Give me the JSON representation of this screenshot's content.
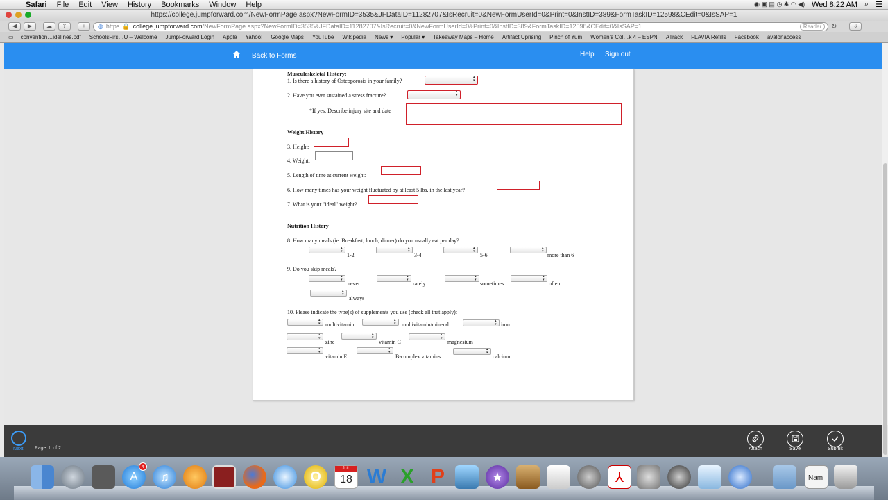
{
  "menubar": {
    "app": "Safari",
    "items": [
      "File",
      "Edit",
      "View",
      "History",
      "Bookmarks",
      "Window",
      "Help"
    ],
    "clock": "Wed 8:22 AM"
  },
  "window": {
    "title": "https://college.jumpforward.com/NewFormPage.aspx?NewFormID=3535&JFDataID=11282707&IsRecruit=0&NewFormUserId=0&Print=0&InstID=389&FormTaskID=12598&CEdit=0&IsSAP=1"
  },
  "toolbar": {
    "url_scheme": "https",
    "url_host": "college.jumpforward.com",
    "url_rest": "/NewFormPage.aspx?NewFormID=3535&JFDataID=11282707&IsRecruit=0&NewFormUserId=0&Print=0&InstID=389&FormTaskID=12598&CEdit=0&IsSAP=1",
    "reader": "Reader"
  },
  "bookmarks": [
    "convention…idelines.pdf",
    "SchoolsFirs…U – Welcome",
    "JumpForward Login",
    "Apple",
    "Yahoo!",
    "Google Maps",
    "YouTube",
    "Wikipedia",
    "News ▾",
    "Popular ▾",
    "Takeaway Maps – Home",
    "Artifact Uprising",
    "Pinch of Yum",
    "Women's Col…k 4 – ESPN",
    "ATrack",
    "FLAVIA Refills",
    "Facebook",
    "avalonaccess"
  ],
  "appbar": {
    "back": "Back to Forms",
    "help": "Help",
    "signout": "Sign out"
  },
  "form": {
    "musculo_heading": "Musculoskeletal History:",
    "q1": "1.  Is there a history of Osteoporosis in your family?",
    "q2": "2.  Have you ever sustained a stress fracture?",
    "q2_detail": "*If yes:  Describe injury site and date",
    "weight_heading": "Weight History",
    "q3": "3. Height:",
    "q4": "4. Weight:",
    "q5": "5. Length of time at current weight:",
    "q6": "6. How many times has your weight fluctuated by at least 5 lbs. in the last year?",
    "q7": "7. What is your \"ideal\" weight?",
    "nutrition_heading": "Nutrition History",
    "q8": "8. How many meals (ie. Breakfast, lunch, dinner) do you usually eat per day?",
    "q8_opts": [
      "1-2",
      "3-4",
      "5-6",
      "more than 6"
    ],
    "q9": "9. Do you skip meals?",
    "q9_opts": [
      "never",
      "rarely",
      "sometimes",
      "often",
      "always"
    ],
    "q10": "10. Please indicate the type(s) of supplements you use (check all that apply):",
    "q10_opts": [
      "multivitamin",
      "multivitamin/mineral",
      "iron",
      "zinc",
      "vitamin C",
      "magnesium",
      "vitamin E",
      "B-complex vitamins",
      "calcium"
    ]
  },
  "bottombar": {
    "next": "Next",
    "page_prefix": "Page",
    "page_num": "1",
    "page_suffix": "of 2",
    "attach": "Attach",
    "save": "Save",
    "submit": "Submit"
  },
  "dock": {
    "calendar_month": "JUL",
    "calendar_day": "18",
    "appstore_badge": "4",
    "finder_label": "Nam"
  }
}
